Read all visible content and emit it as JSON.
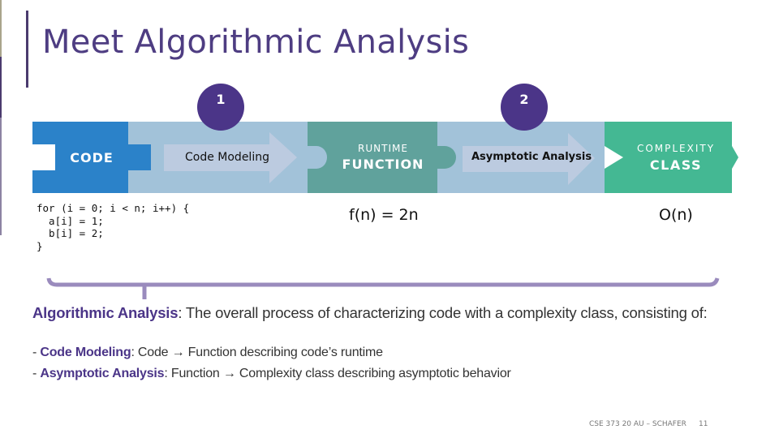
{
  "slide": {
    "title": "Meet Algorithmic Analysis",
    "colors": {
      "accent_purple": "#4b3588",
      "code_blue": "#2b82c9",
      "step_light_blue": "#a2c2d9",
      "arrow_fill": "#bccbe0",
      "function_teal": "#60a29c",
      "class_green": "#44b893",
      "bracket": "#9a8bbd"
    }
  },
  "diagram": {
    "steps": [
      {
        "number": "1",
        "label": "Code Modeling"
      },
      {
        "number": "2",
        "label": "Asymptotic Analysis"
      }
    ],
    "stages": {
      "code": {
        "title": "CODE"
      },
      "function": {
        "subtitle": "RUNTIME",
        "title": "FUNCTION"
      },
      "class": {
        "subtitle": "COMPLEXITY",
        "title": "CLASS"
      }
    },
    "code_sample": "for (i = 0; i < n; i++) {\n  a[i] = 1;\n  b[i] = 2;\n}",
    "runtime_function": "f(n) = 2n",
    "complexity_class": "O(n)"
  },
  "definition": {
    "term": "Algorithmic Analysis",
    "text": ": The overall process of characterizing code with a complexity class, consisting of:",
    "bullets": [
      {
        "dash": "- ",
        "term": "Code Modeling",
        "text": ": Code → Function describing code’s runtime"
      },
      {
        "dash": "- ",
        "term": "Asymptotic Analysis",
        "text": ": Function → Complexity class describing asymptotic behavior"
      }
    ]
  },
  "footer": {
    "course": "CSE 373 20 AU – SCHAFER",
    "page": "11"
  }
}
